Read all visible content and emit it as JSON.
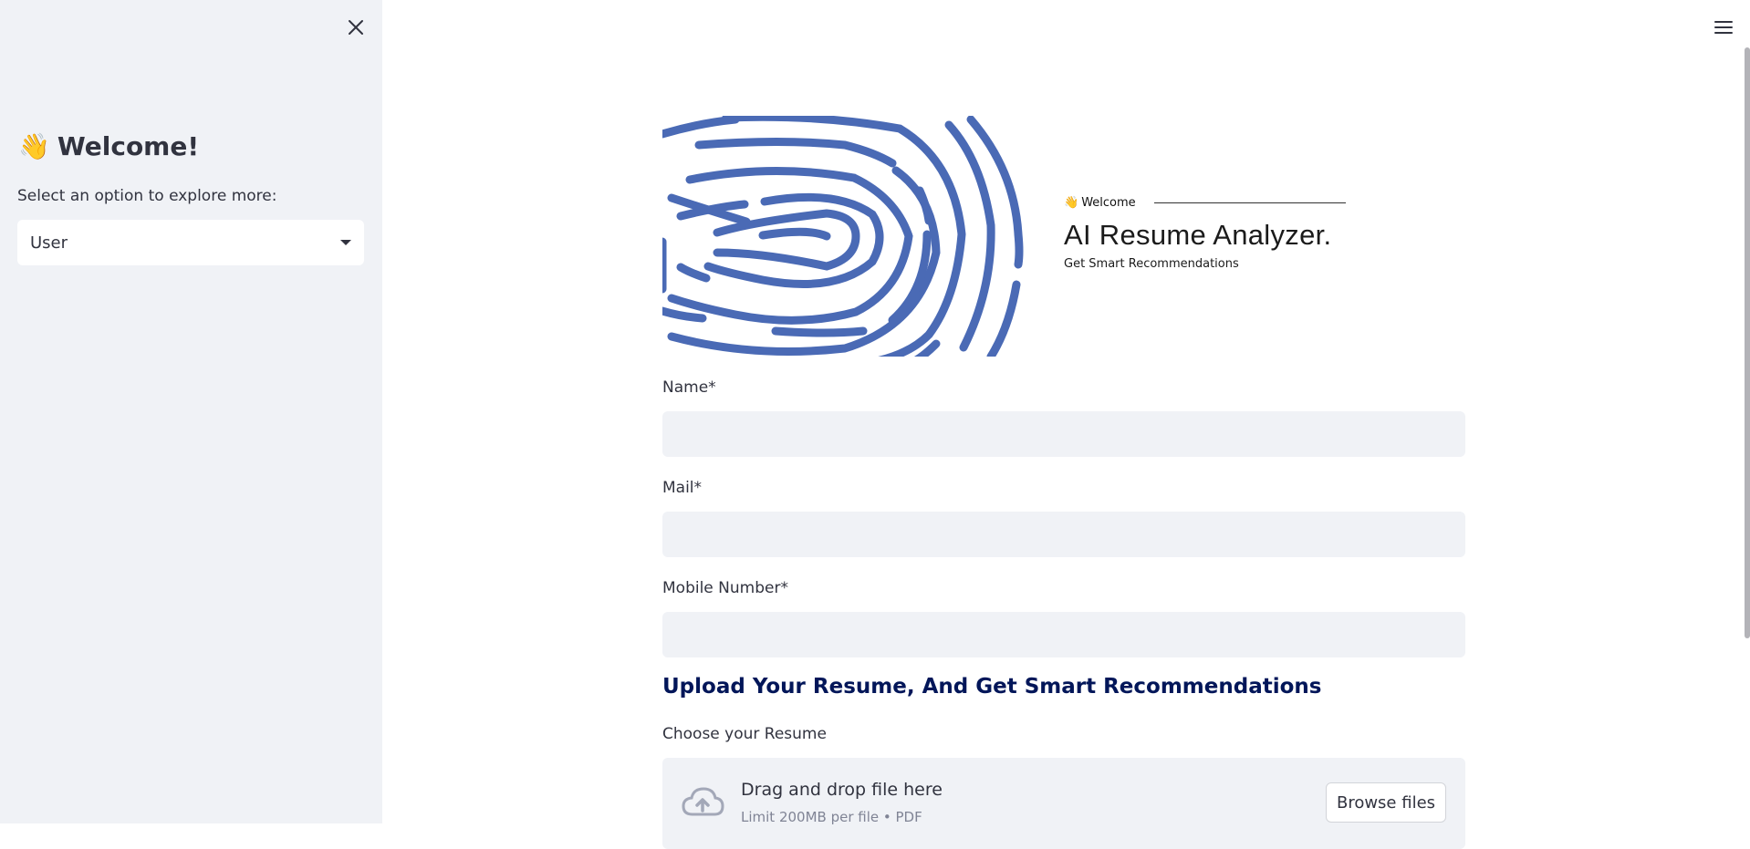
{
  "sidebar": {
    "welcome_emoji": "👋",
    "title": "Welcome!",
    "subtitle": "Select an option to explore more:",
    "select_value": "User"
  },
  "banner": {
    "welcome_emoji": "👋",
    "welcome_text": "Welcome",
    "title": "AI Resume Analyzer.",
    "subtitle": "Get Smart Recommendations",
    "fingerprint_color": "#4a6ab5"
  },
  "form": {
    "name_label": "Name*",
    "name_value": "",
    "mail_label": "Mail*",
    "mail_value": "",
    "mobile_label": "Mobile Number*",
    "mobile_value": ""
  },
  "upload": {
    "heading": "Upload Your Resume, And Get Smart Recommendations",
    "label": "Choose your Resume",
    "drop_text": "Drag and drop file here",
    "limit_text": "Limit 200MB per file • PDF",
    "browse_label": "Browse files"
  },
  "colors": {
    "sidebar_bg": "#f0f2f6",
    "heading": "#021659",
    "text": "#31333f"
  }
}
